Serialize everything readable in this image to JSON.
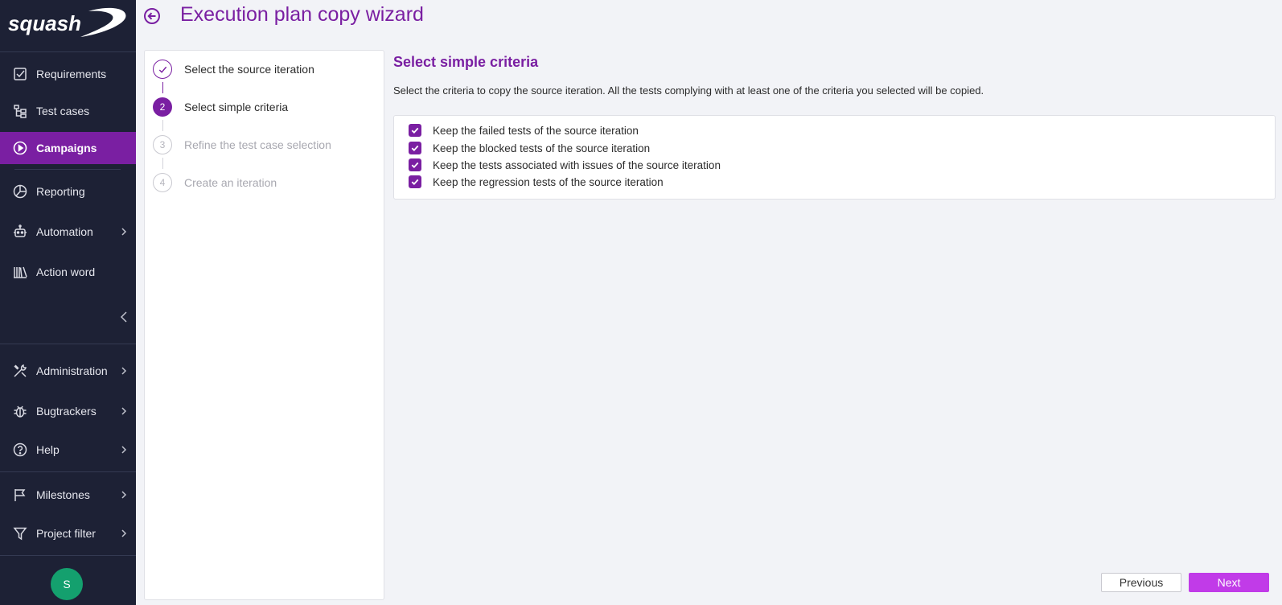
{
  "app": {
    "logo_text": "squash"
  },
  "sidebar": {
    "items": [
      {
        "label": "Requirements",
        "icon": "checkbox-icon"
      },
      {
        "label": "Test cases",
        "icon": "tree-icon"
      },
      {
        "label": "Campaigns",
        "icon": "play-circle-icon",
        "active": true
      },
      {
        "label": "Reporting",
        "icon": "pie-chart-icon"
      },
      {
        "label": "Automation",
        "icon": "robot-icon"
      },
      {
        "label": "Action word",
        "icon": "library-icon"
      },
      {
        "label": "Administration",
        "icon": "tools-icon"
      },
      {
        "label": "Bugtrackers",
        "icon": "bug-icon"
      },
      {
        "label": "Help",
        "icon": "help-circle-icon"
      },
      {
        "label": "Milestones",
        "icon": "flag-icon"
      },
      {
        "label": "Project filter",
        "icon": "filter-icon"
      }
    ],
    "avatar_initial": "S"
  },
  "header": {
    "title": "Execution plan copy wizard"
  },
  "wizard": {
    "steps": [
      {
        "number": "1",
        "label": "Select the source iteration",
        "state": "done"
      },
      {
        "number": "2",
        "label": "Select simple criteria",
        "state": "current"
      },
      {
        "number": "3",
        "label": "Refine the test case selection",
        "state": "todo"
      },
      {
        "number": "4",
        "label": "Create an iteration",
        "state": "todo"
      }
    ]
  },
  "main": {
    "section_title": "Select simple criteria",
    "description": "Select the criteria to copy the source iteration. All the tests complying with at least one of the criteria you selected will be copied.",
    "criteria": [
      {
        "label": "Keep the failed tests of the source iteration",
        "checked": true
      },
      {
        "label": "Keep the blocked tests of the source iteration",
        "checked": true
      },
      {
        "label": "Keep the tests associated with issues of the source iteration",
        "checked": true
      },
      {
        "label": "Keep the regression tests of the source iteration",
        "checked": true
      }
    ]
  },
  "footer": {
    "previous_label": "Previous",
    "next_label": "Next"
  },
  "colors": {
    "sidebar_bg": "#1d2135",
    "accent": "#7a1fa2",
    "next_button": "#c13be8",
    "avatar": "#14a06e"
  }
}
